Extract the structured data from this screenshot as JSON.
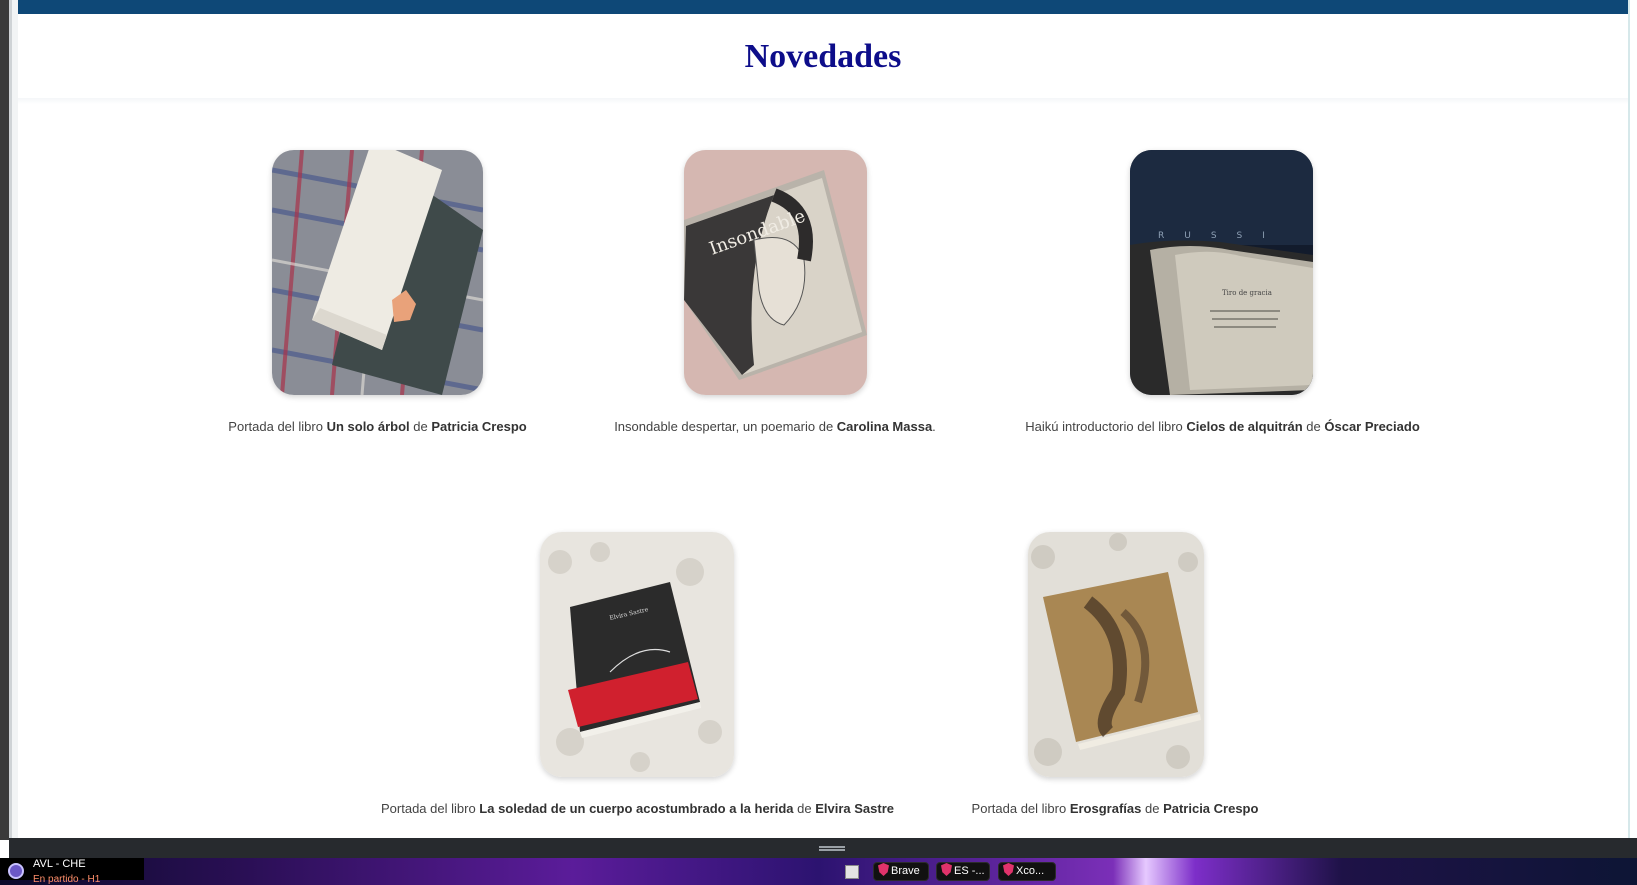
{
  "page": {
    "title": "Novedades",
    "accent_color": "#0e4877",
    "title_color": "#0d0d8a"
  },
  "books": [
    {
      "image_alt": "Un solo árbol book cover on plaid fabric",
      "caption_prefix": "Portada del libro ",
      "caption_title": "Un solo árbol",
      "caption_mid": " de ",
      "caption_author": "Patricia Crespo",
      "caption_suffix": ""
    },
    {
      "image_alt": "Insondable despertar book on pink fabric",
      "caption_prefix": "Insondable despertar, un poemario de ",
      "caption_title": "",
      "caption_mid": "",
      "caption_author": "Carolina Massa",
      "caption_suffix": "."
    },
    {
      "image_alt": "Open book showing haiku page",
      "caption_prefix": "Haikú introductorio del libro ",
      "caption_title": "Cielos de alquitrán",
      "caption_mid": " de ",
      "caption_author": "Óscar Preciado",
      "caption_suffix": ""
    },
    {
      "image_alt": "La soledad de un cuerpo acostumbrado a la herida book on sherpa blanket",
      "caption_prefix": "Portada del libro ",
      "caption_title": "La soledad de un cuerpo acostumbrado a la herida",
      "caption_mid": " de ",
      "caption_author": "Elvira Sastre",
      "caption_suffix": ""
    },
    {
      "image_alt": "Erosgrafías book on sherpa blanket",
      "caption_prefix": "Portada del libro ",
      "caption_title": "Erosgrafías",
      "caption_mid": " de ",
      "caption_author": "Patricia Crespo",
      "caption_suffix": ""
    }
  ],
  "taskbar": {
    "now_playing_title": "AVL - CHE",
    "now_playing_status": "En partido - H1",
    "buttons": [
      {
        "label": "Brave",
        "icon": "brave-icon"
      },
      {
        "label": "ES -...",
        "icon": "brave-icon"
      },
      {
        "label": "Xco...",
        "icon": "brave-icon"
      }
    ]
  }
}
